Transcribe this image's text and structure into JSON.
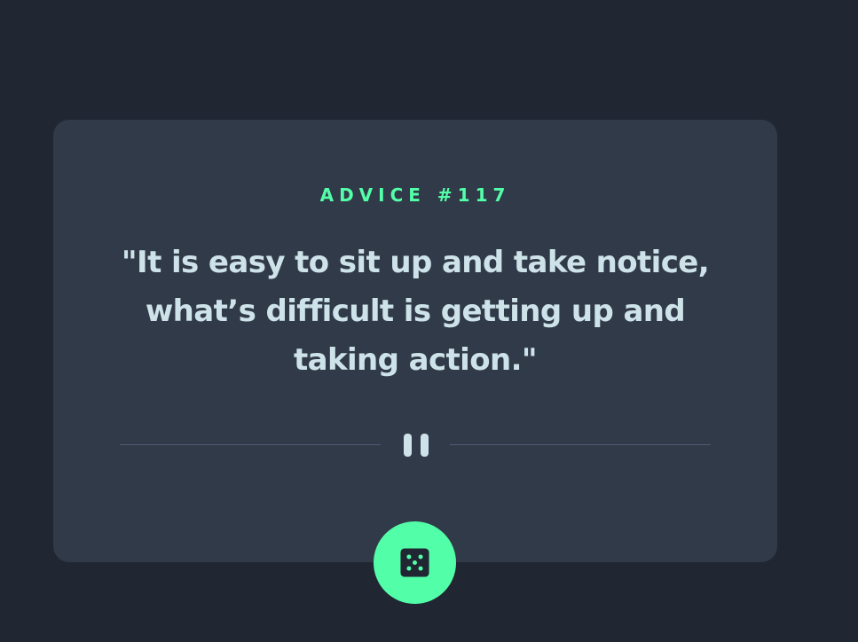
{
  "advice": {
    "title": "ADVICE #117",
    "quote": "\"It is easy to sit up and take notice, what’s difficult is getting up and taking action.\""
  },
  "colors": {
    "background": "#202632",
    "card": "#313a48",
    "accent": "#52ffa8",
    "text": "#cee3e9",
    "divider": "#4f5d74"
  },
  "icons": {
    "divider": "pause-icon",
    "button": "dice-icon"
  }
}
